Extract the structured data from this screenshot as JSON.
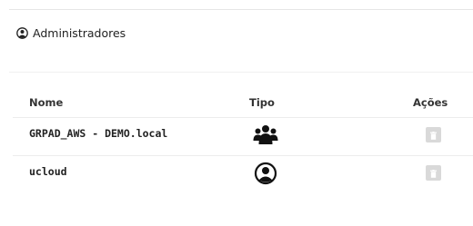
{
  "panel": {
    "title": "Administradores",
    "icon": "user-circle-icon"
  },
  "table": {
    "headers": {
      "name": "Nome",
      "type": "Tipo",
      "actions": "Ações"
    },
    "rows": [
      {
        "name": "GRPAD_AWS - DEMO.local",
        "type_icon": "users-group-icon",
        "action_icon": "trash-icon"
      },
      {
        "name": "ucloud",
        "type_icon": "user-circle-icon",
        "action_icon": "trash-icon"
      }
    ]
  },
  "colors": {
    "text": "#222222",
    "divider": "#ececec",
    "action_button_bg": "#d9d9d9"
  }
}
